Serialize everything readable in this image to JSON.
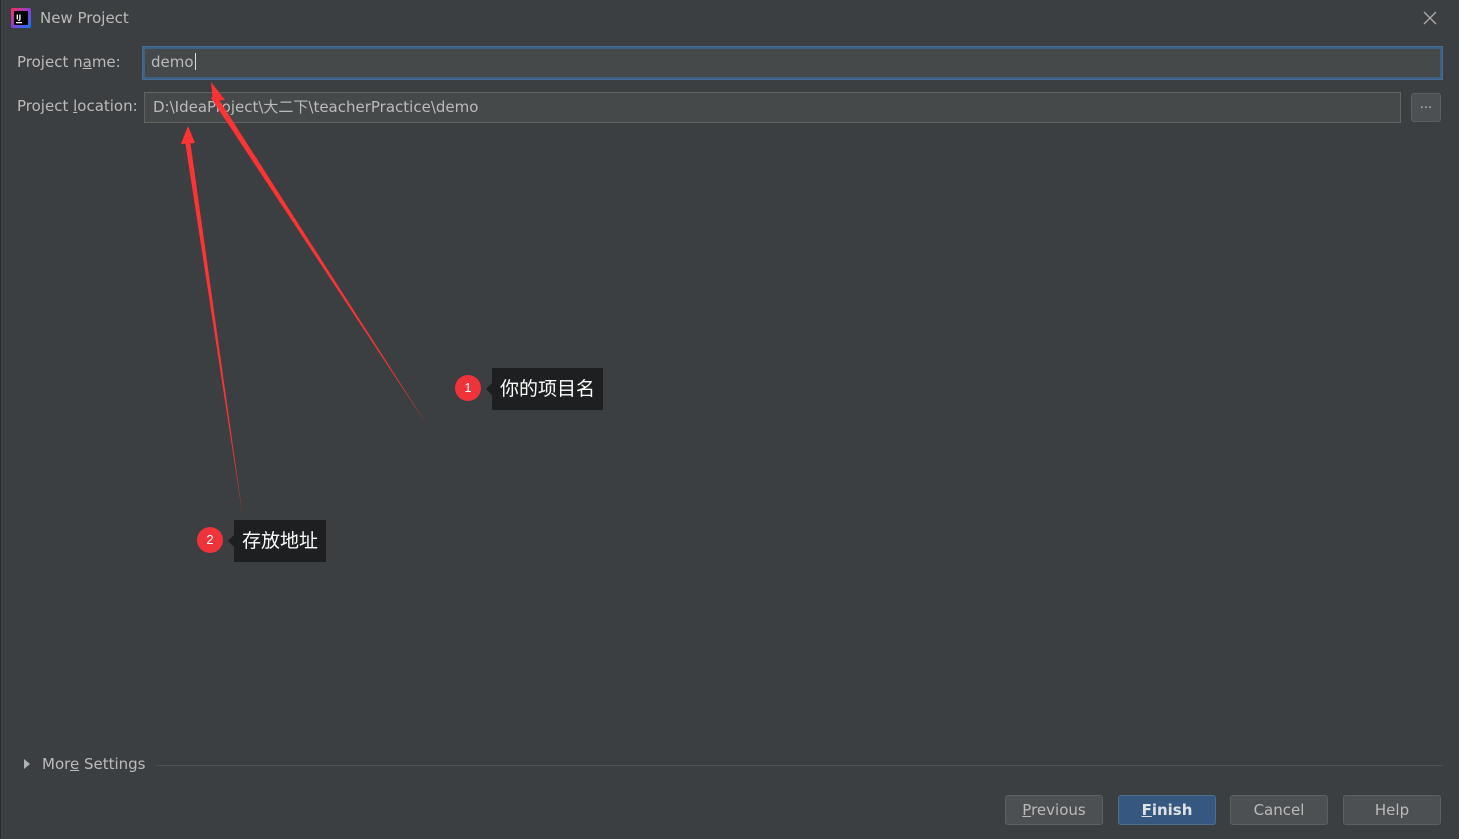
{
  "window": {
    "title": "New Project",
    "close_icon": "close-icon",
    "app_icon": "intellij-idea-icon"
  },
  "form": {
    "name_label_pre": "Project n",
    "name_label_u": "a",
    "name_label_post": "me:",
    "name_value": "demo",
    "location_label_pre": "Project ",
    "location_label_u": "l",
    "location_label_post": "ocation:",
    "location_value": "D:\\IdeaProject\\大二下\\teacherPractice\\demo",
    "browse_label": "..."
  },
  "more_settings": {
    "label_pre": "Mor",
    "label_u": "e",
    "label_post": " Settings",
    "icon": "expand-triangle-icon"
  },
  "buttons": {
    "previous_u": "P",
    "previous_rest": "revious",
    "finish_u": "F",
    "finish_rest": "inish",
    "cancel": "Cancel",
    "help": "Help"
  },
  "annotations": {
    "note1_number": "1",
    "note1_text": "你的项目名",
    "note2_number": "2",
    "note2_text": "存放地址",
    "arrow_color": "#ff3333"
  },
  "colors": {
    "background": "#3c3f41",
    "primary_button": "#365880",
    "focus_border": "#3d6185"
  }
}
